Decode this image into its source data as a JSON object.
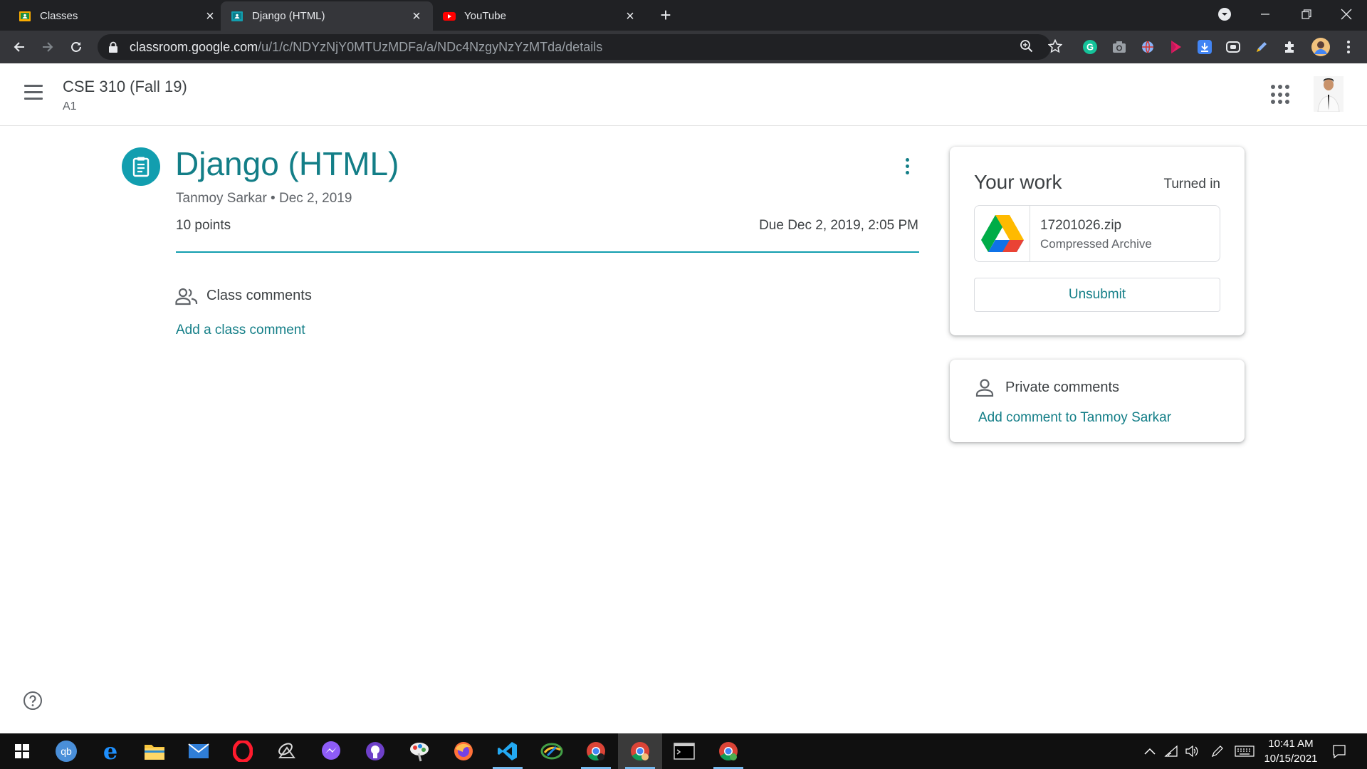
{
  "browser": {
    "tabs": [
      {
        "title": "Classes",
        "icon": "classroom-icon"
      },
      {
        "title": "Django (HTML)",
        "icon": "classroom-assignment-icon",
        "active": true
      },
      {
        "title": "YouTube",
        "icon": "youtube-icon"
      }
    ],
    "url_host": "classroom.google.com",
    "url_path": "/u/1/c/NDYzNjY0MTUzMDFa/a/NDc4NzgyNzYzMTda/details"
  },
  "header": {
    "course_title": "CSE 310 (Fall 19)",
    "course_section": "A1"
  },
  "assignment": {
    "title": "Django (HTML)",
    "meta": "Tanmoy Sarkar • Dec 2, 2019",
    "points": "10 points",
    "due": "Due Dec 2, 2019, 2:05 PM"
  },
  "class_comments": {
    "label": "Class comments",
    "add_link": "Add a class comment"
  },
  "your_work": {
    "title": "Your work",
    "status": "Turned in",
    "attachment": {
      "name": "17201026.zip",
      "type": "Compressed Archive",
      "icon": "google-drive-icon"
    },
    "unsubmit_label": "Unsubmit"
  },
  "private_comments": {
    "label": "Private comments",
    "add_link": "Add comment to Tanmoy Sarkar"
  },
  "taskbar": {
    "time": "10:41 AM",
    "date": "10/15/2021"
  },
  "colors": {
    "accent": "#137e87",
    "assignment_icon_bg": "#129eaf",
    "chrome_dark": "#202124",
    "chrome_toolbar": "#35363a"
  }
}
